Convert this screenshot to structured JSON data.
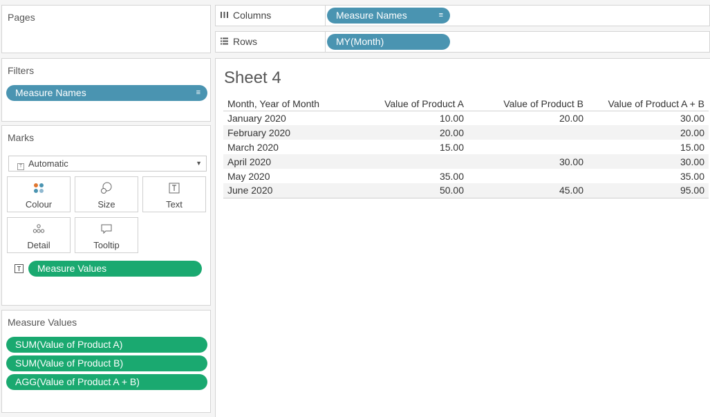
{
  "pages": {
    "title": "Pages"
  },
  "filters": {
    "title": "Filters",
    "items": [
      {
        "label": "Measure Names"
      }
    ]
  },
  "marks": {
    "title": "Marks",
    "mark_type": "Automatic",
    "buttons": {
      "colour": "Colour",
      "size": "Size",
      "text": "Text",
      "detail": "Detail",
      "tooltip": "Tooltip"
    },
    "text_pill": "Measure Values"
  },
  "measure_values": {
    "title": "Measure Values",
    "items": [
      {
        "label": "SUM(Value of Product A)"
      },
      {
        "label": "SUM(Value of Product B)"
      },
      {
        "label": "AGG(Value of Product A + B)"
      }
    ]
  },
  "shelves": {
    "columns": {
      "label": "Columns",
      "pill": "Measure Names"
    },
    "rows": {
      "label": "Rows",
      "pill": "MY(Month)"
    }
  },
  "colors": {
    "dimension_pill": "#4a94b1",
    "measure_pill": "#1aa970"
  },
  "sheet": {
    "title": "Sheet 4",
    "columns": [
      "Month, Year of Month",
      "Value of Product A",
      "Value of Product B",
      "Value of Product A + B"
    ],
    "rows": [
      {
        "month": "January 2020",
        "a": "10.00",
        "b": "20.00",
        "ab": "30.00"
      },
      {
        "month": "February 2020",
        "a": "20.00",
        "b": "",
        "ab": "20.00"
      },
      {
        "month": "March 2020",
        "a": "15.00",
        "b": "",
        "ab": "15.00"
      },
      {
        "month": "April 2020",
        "a": "",
        "b": "30.00",
        "ab": "30.00"
      },
      {
        "month": "May 2020",
        "a": "35.00",
        "b": "",
        "ab": "35.00"
      },
      {
        "month": "June 2020",
        "a": "50.00",
        "b": "45.00",
        "ab": "95.00"
      }
    ]
  }
}
